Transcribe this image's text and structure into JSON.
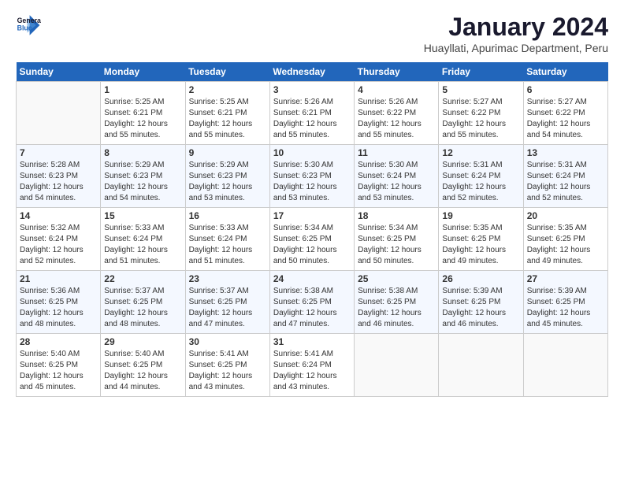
{
  "logo": {
    "line1": "General",
    "line2": "Blue"
  },
  "title": "January 2024",
  "subtitle": "Huayllati, Apurimac Department, Peru",
  "days_of_week": [
    "Sunday",
    "Monday",
    "Tuesday",
    "Wednesday",
    "Thursday",
    "Friday",
    "Saturday"
  ],
  "weeks": [
    [
      {
        "date": "",
        "info": ""
      },
      {
        "date": "1",
        "info": "Sunrise: 5:25 AM\nSunset: 6:21 PM\nDaylight: 12 hours\nand 55 minutes."
      },
      {
        "date": "2",
        "info": "Sunrise: 5:25 AM\nSunset: 6:21 PM\nDaylight: 12 hours\nand 55 minutes."
      },
      {
        "date": "3",
        "info": "Sunrise: 5:26 AM\nSunset: 6:21 PM\nDaylight: 12 hours\nand 55 minutes."
      },
      {
        "date": "4",
        "info": "Sunrise: 5:26 AM\nSunset: 6:22 PM\nDaylight: 12 hours\nand 55 minutes."
      },
      {
        "date": "5",
        "info": "Sunrise: 5:27 AM\nSunset: 6:22 PM\nDaylight: 12 hours\nand 55 minutes."
      },
      {
        "date": "6",
        "info": "Sunrise: 5:27 AM\nSunset: 6:22 PM\nDaylight: 12 hours\nand 54 minutes."
      }
    ],
    [
      {
        "date": "7",
        "info": "Sunrise: 5:28 AM\nSunset: 6:23 PM\nDaylight: 12 hours\nand 54 minutes."
      },
      {
        "date": "8",
        "info": "Sunrise: 5:29 AM\nSunset: 6:23 PM\nDaylight: 12 hours\nand 54 minutes."
      },
      {
        "date": "9",
        "info": "Sunrise: 5:29 AM\nSunset: 6:23 PM\nDaylight: 12 hours\nand 53 minutes."
      },
      {
        "date": "10",
        "info": "Sunrise: 5:30 AM\nSunset: 6:23 PM\nDaylight: 12 hours\nand 53 minutes."
      },
      {
        "date": "11",
        "info": "Sunrise: 5:30 AM\nSunset: 6:24 PM\nDaylight: 12 hours\nand 53 minutes."
      },
      {
        "date": "12",
        "info": "Sunrise: 5:31 AM\nSunset: 6:24 PM\nDaylight: 12 hours\nand 52 minutes."
      },
      {
        "date": "13",
        "info": "Sunrise: 5:31 AM\nSunset: 6:24 PM\nDaylight: 12 hours\nand 52 minutes."
      }
    ],
    [
      {
        "date": "14",
        "info": "Sunrise: 5:32 AM\nSunset: 6:24 PM\nDaylight: 12 hours\nand 52 minutes."
      },
      {
        "date": "15",
        "info": "Sunrise: 5:33 AM\nSunset: 6:24 PM\nDaylight: 12 hours\nand 51 minutes."
      },
      {
        "date": "16",
        "info": "Sunrise: 5:33 AM\nSunset: 6:24 PM\nDaylight: 12 hours\nand 51 minutes."
      },
      {
        "date": "17",
        "info": "Sunrise: 5:34 AM\nSunset: 6:25 PM\nDaylight: 12 hours\nand 50 minutes."
      },
      {
        "date": "18",
        "info": "Sunrise: 5:34 AM\nSunset: 6:25 PM\nDaylight: 12 hours\nand 50 minutes."
      },
      {
        "date": "19",
        "info": "Sunrise: 5:35 AM\nSunset: 6:25 PM\nDaylight: 12 hours\nand 49 minutes."
      },
      {
        "date": "20",
        "info": "Sunrise: 5:35 AM\nSunset: 6:25 PM\nDaylight: 12 hours\nand 49 minutes."
      }
    ],
    [
      {
        "date": "21",
        "info": "Sunrise: 5:36 AM\nSunset: 6:25 PM\nDaylight: 12 hours\nand 48 minutes."
      },
      {
        "date": "22",
        "info": "Sunrise: 5:37 AM\nSunset: 6:25 PM\nDaylight: 12 hours\nand 48 minutes."
      },
      {
        "date": "23",
        "info": "Sunrise: 5:37 AM\nSunset: 6:25 PM\nDaylight: 12 hours\nand 47 minutes."
      },
      {
        "date": "24",
        "info": "Sunrise: 5:38 AM\nSunset: 6:25 PM\nDaylight: 12 hours\nand 47 minutes."
      },
      {
        "date": "25",
        "info": "Sunrise: 5:38 AM\nSunset: 6:25 PM\nDaylight: 12 hours\nand 46 minutes."
      },
      {
        "date": "26",
        "info": "Sunrise: 5:39 AM\nSunset: 6:25 PM\nDaylight: 12 hours\nand 46 minutes."
      },
      {
        "date": "27",
        "info": "Sunrise: 5:39 AM\nSunset: 6:25 PM\nDaylight: 12 hours\nand 45 minutes."
      }
    ],
    [
      {
        "date": "28",
        "info": "Sunrise: 5:40 AM\nSunset: 6:25 PM\nDaylight: 12 hours\nand 45 minutes."
      },
      {
        "date": "29",
        "info": "Sunrise: 5:40 AM\nSunset: 6:25 PM\nDaylight: 12 hours\nand 44 minutes."
      },
      {
        "date": "30",
        "info": "Sunrise: 5:41 AM\nSunset: 6:25 PM\nDaylight: 12 hours\nand 43 minutes."
      },
      {
        "date": "31",
        "info": "Sunrise: 5:41 AM\nSunset: 6:24 PM\nDaylight: 12 hours\nand 43 minutes."
      },
      {
        "date": "",
        "info": ""
      },
      {
        "date": "",
        "info": ""
      },
      {
        "date": "",
        "info": ""
      }
    ]
  ]
}
